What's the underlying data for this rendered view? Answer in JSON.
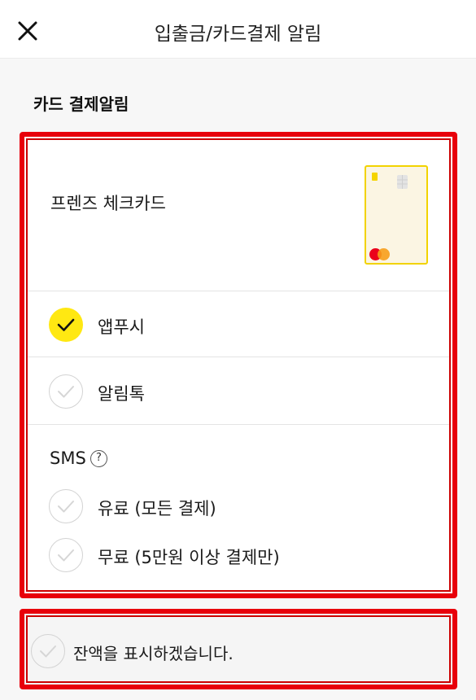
{
  "header": {
    "title": "입출금/카드결제 알림",
    "close_icon": "close-icon"
  },
  "section": {
    "title": "카드 결제알림"
  },
  "card": {
    "name": "프렌즈 체크카드",
    "accent_color": "#ffe812",
    "highlight_color": "#e8000b"
  },
  "options": {
    "app_push": {
      "label": "앱푸시",
      "checked": true
    },
    "alimtalk": {
      "label": "알림톡",
      "checked": false
    },
    "sms": {
      "label": "SMS",
      "help": "?",
      "paid": {
        "label": "유료 (모든 결제)",
        "checked": false
      },
      "free": {
        "label": "무료 (5만원 이상 결제만)",
        "checked": false
      }
    }
  },
  "balance": {
    "label": "잔액을 표시하겠습니다.",
    "checked": false
  }
}
